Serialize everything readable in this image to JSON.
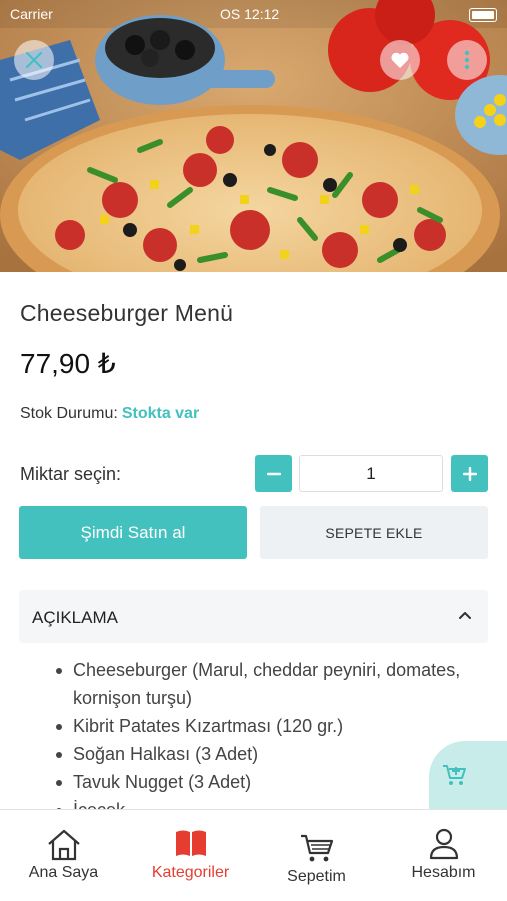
{
  "status_bar": {
    "carrier": "Carrier",
    "time": "OS 12:12"
  },
  "product": {
    "title": "Cheeseburger Menü",
    "price": "77,90 ₺",
    "stock_label": "Stok Durumu:",
    "stock_value": "Stokta var"
  },
  "quantity": {
    "label": "Miktar seçin:",
    "value": "1",
    "minus": "−",
    "plus": "+"
  },
  "actions": {
    "buy_now": "Şimdi Satın al",
    "add_to_cart": "SEPETE EKLE"
  },
  "description": {
    "header": "AÇIKLAMA",
    "items": [
      "Cheeseburger (Marul, cheddar peyniri, domates, kornişon turşu)",
      "Kibrit Patates Kızartması (120 gr.)",
      "Soğan Halkası (3 Adet)",
      "Tavuk Nugget (3 Adet)",
      "İçecek"
    ]
  },
  "tabbar": [
    {
      "label": "Ana Saya",
      "icon": "home-icon"
    },
    {
      "label": "Kategoriler",
      "icon": "book-icon"
    },
    {
      "label": "Sepetim",
      "icon": "cart-icon"
    },
    {
      "label": "Hesabım",
      "icon": "user-icon"
    }
  ],
  "colors": {
    "accent": "#43c1bf",
    "active_tab": "#e53d2f"
  }
}
